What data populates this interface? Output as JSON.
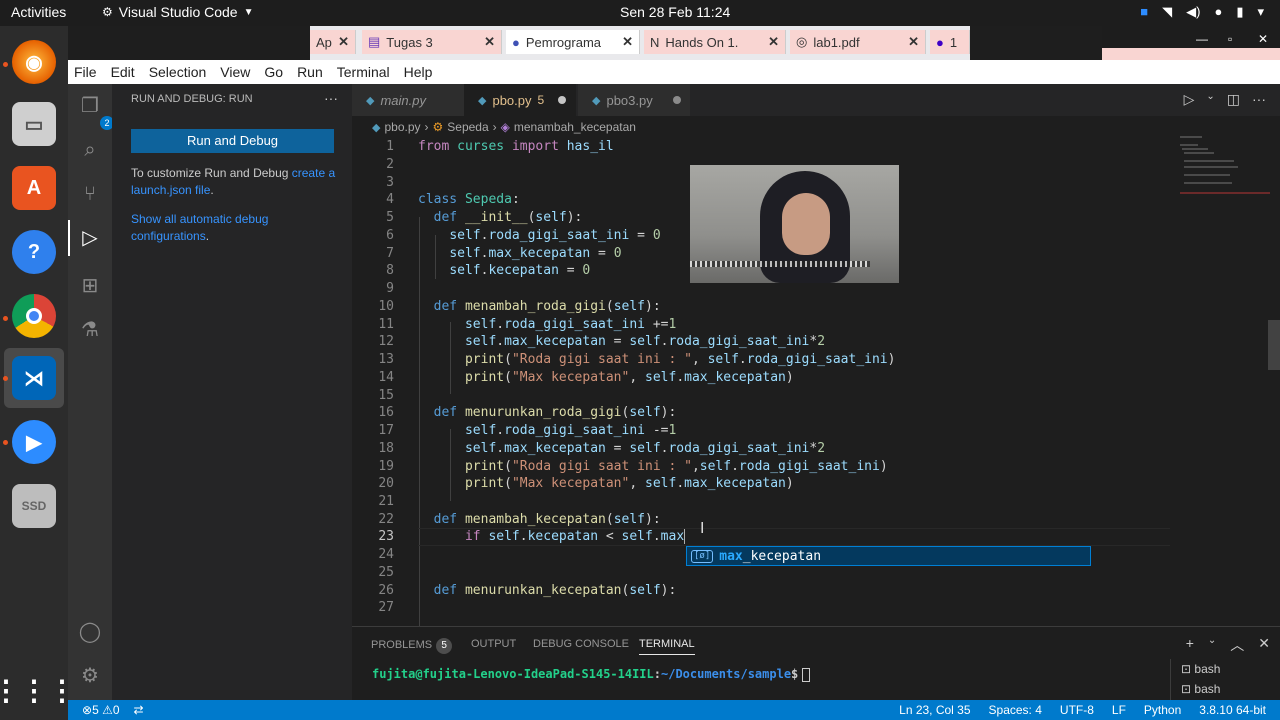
{
  "topbar": {
    "activities": "Activities",
    "app": "Visual Studio Code",
    "clock": "Sen 28 Feb  11:24"
  },
  "browser_tabs": [
    {
      "label": "Ap",
      "active": false
    },
    {
      "label": "Tugas 3",
      "active": false
    },
    {
      "label": "Pemrograma",
      "active": true
    },
    {
      "label": "Hands On 1.",
      "active": false
    },
    {
      "label": "lab1.pdf",
      "active": false
    },
    {
      "label": "1",
      "active": false
    }
  ],
  "menu": [
    "File",
    "Edit",
    "Selection",
    "View",
    "Go",
    "Run",
    "Terminal",
    "Help"
  ],
  "activity_bar": {
    "explorer_badge": "2"
  },
  "sidebar": {
    "title": "RUN AND DEBUG: RUN",
    "more": "···",
    "run_button": "Run and Debug",
    "customize_text": "To customize Run and Debug ",
    "customize_link": "create a launch.json file",
    "customize_end": ".",
    "show_link": "Show all automatic debug configurations",
    "show_end": "."
  },
  "editor_tabs": [
    {
      "label": "main.py",
      "active": false,
      "modified": false,
      "suffix": ""
    },
    {
      "label": "pbo.py",
      "active": true,
      "modified": true,
      "suffix": "5"
    },
    {
      "label": "pbo3.py",
      "active": false,
      "modified": true,
      "suffix": ""
    }
  ],
  "breadcrumb": [
    "pbo.py",
    "Sepeda",
    "menambah_kecepatan"
  ],
  "code_lines": [
    "1",
    "2",
    "3",
    "4",
    "5",
    "6",
    "7",
    "8",
    "9",
    "10",
    "11",
    "12",
    "13",
    "14",
    "15",
    "16",
    "17",
    "18",
    "19",
    "20",
    "21",
    "22",
    "23",
    "24",
    "25",
    "26",
    "27"
  ],
  "current_line": "23",
  "suggestion": {
    "icon": "[ø]",
    "match": "max",
    "rest": "_kecepatan"
  },
  "panel": {
    "tabs": [
      "PROBLEMS",
      "OUTPUT",
      "DEBUG CONSOLE",
      "TERMINAL"
    ],
    "problems_count": "5",
    "prompt_user": "fujita@fujita-Lenovo-IdeaPad-S145-14IIL",
    "prompt_sep": ":",
    "prompt_path": "~/Documents/sample",
    "prompt_sym": "$",
    "terminals": [
      "bash",
      "bash"
    ]
  },
  "statusbar": {
    "errors": "5",
    "warnings": "0",
    "position": "Ln 23, Col 35",
    "spaces": "Spaces: 4",
    "encoding": "UTF-8",
    "eol": "LF",
    "language": "Python",
    "interpreter": "3.8.10 64-bit"
  },
  "colors": {
    "accent": "#007acc",
    "button": "#0e639c"
  }
}
